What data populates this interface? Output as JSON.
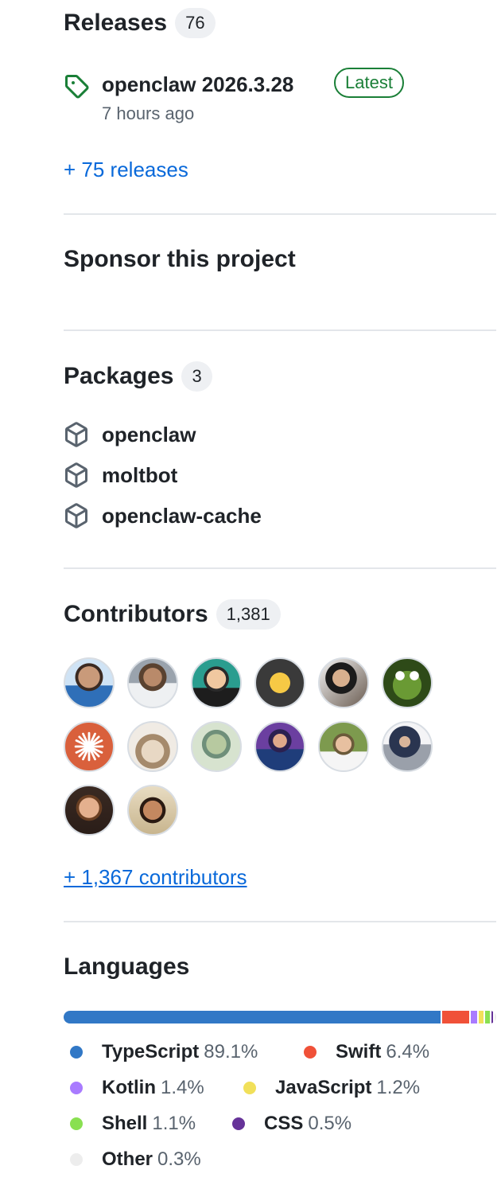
{
  "releases": {
    "title": "Releases",
    "count": "76",
    "latest": {
      "name": "openclaw 2026.3.28",
      "badge": "Latest",
      "time": "7 hours ago"
    },
    "more_link": "+ 75 releases"
  },
  "sponsor": {
    "title": "Sponsor this project"
  },
  "packages": {
    "title": "Packages",
    "count": "3",
    "items": [
      "openclaw",
      "moltbot",
      "openclaw-cache"
    ]
  },
  "contributors": {
    "title": "Contributors",
    "count": "1,381",
    "more_link": "+ 1,367 contributors",
    "avatars": [
      {
        "name": "contributor-avatar-1"
      },
      {
        "name": "contributor-avatar-2"
      },
      {
        "name": "contributor-avatar-3"
      },
      {
        "name": "contributor-avatar-4"
      },
      {
        "name": "contributor-avatar-5"
      },
      {
        "name": "contributor-avatar-6"
      },
      {
        "name": "contributor-avatar-7"
      },
      {
        "name": "contributor-avatar-8"
      },
      {
        "name": "contributor-avatar-9"
      },
      {
        "name": "contributor-avatar-10"
      },
      {
        "name": "contributor-avatar-11"
      },
      {
        "name": "contributor-avatar-12"
      },
      {
        "name": "contributor-avatar-13"
      },
      {
        "name": "contributor-avatar-14"
      }
    ]
  },
  "languages": {
    "title": "Languages",
    "items": [
      {
        "name": "TypeScript",
        "percent": "89.1%",
        "value": 89.1,
        "color": "#3178c6"
      },
      {
        "name": "Swift",
        "percent": "6.4%",
        "value": 6.4,
        "color": "#f05138"
      },
      {
        "name": "Kotlin",
        "percent": "1.4%",
        "value": 1.4,
        "color": "#a97bff"
      },
      {
        "name": "JavaScript",
        "percent": "1.2%",
        "value": 1.2,
        "color": "#f1e05a"
      },
      {
        "name": "Shell",
        "percent": "1.1%",
        "value": 1.1,
        "color": "#89e051"
      },
      {
        "name": "CSS",
        "percent": "0.5%",
        "value": 0.5,
        "color": "#663399"
      },
      {
        "name": "Other",
        "percent": "0.3%",
        "value": 0.3,
        "color": "#ededed"
      }
    ]
  }
}
